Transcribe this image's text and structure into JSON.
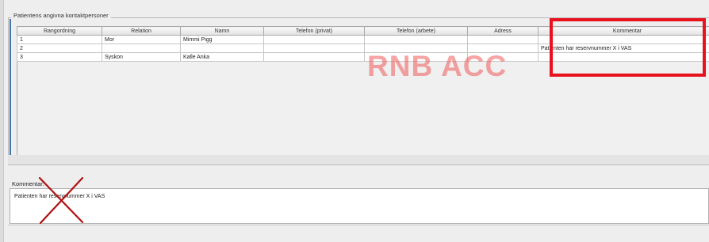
{
  "group": {
    "title": "Patientens angivna kontaktpersoner"
  },
  "table": {
    "columns": [
      "Rangordning",
      "Relation",
      "Namn",
      "Telefon (privat)",
      "Telefon (arbete)",
      "Adress",
      "Kommentar"
    ],
    "rows": [
      [
        "1",
        "Mor",
        "Mimmi Pigg",
        "",
        "",
        "",
        ""
      ],
      [
        "2",
        "",
        "",
        "",
        "",
        "",
        "Patienten har reservnummer X i VAS"
      ],
      [
        "3",
        "Syskon",
        "Kalle Anka",
        "",
        "",
        "",
        ""
      ]
    ]
  },
  "watermark": "RNB ACC",
  "kommentar": {
    "label": "Kommentar:",
    "value": "Patienten har reservnummer X i VAS"
  },
  "colors": {
    "highlight_box": "#e8121e",
    "cross_mark": "#b01010",
    "watermark": "#f05a5a"
  }
}
